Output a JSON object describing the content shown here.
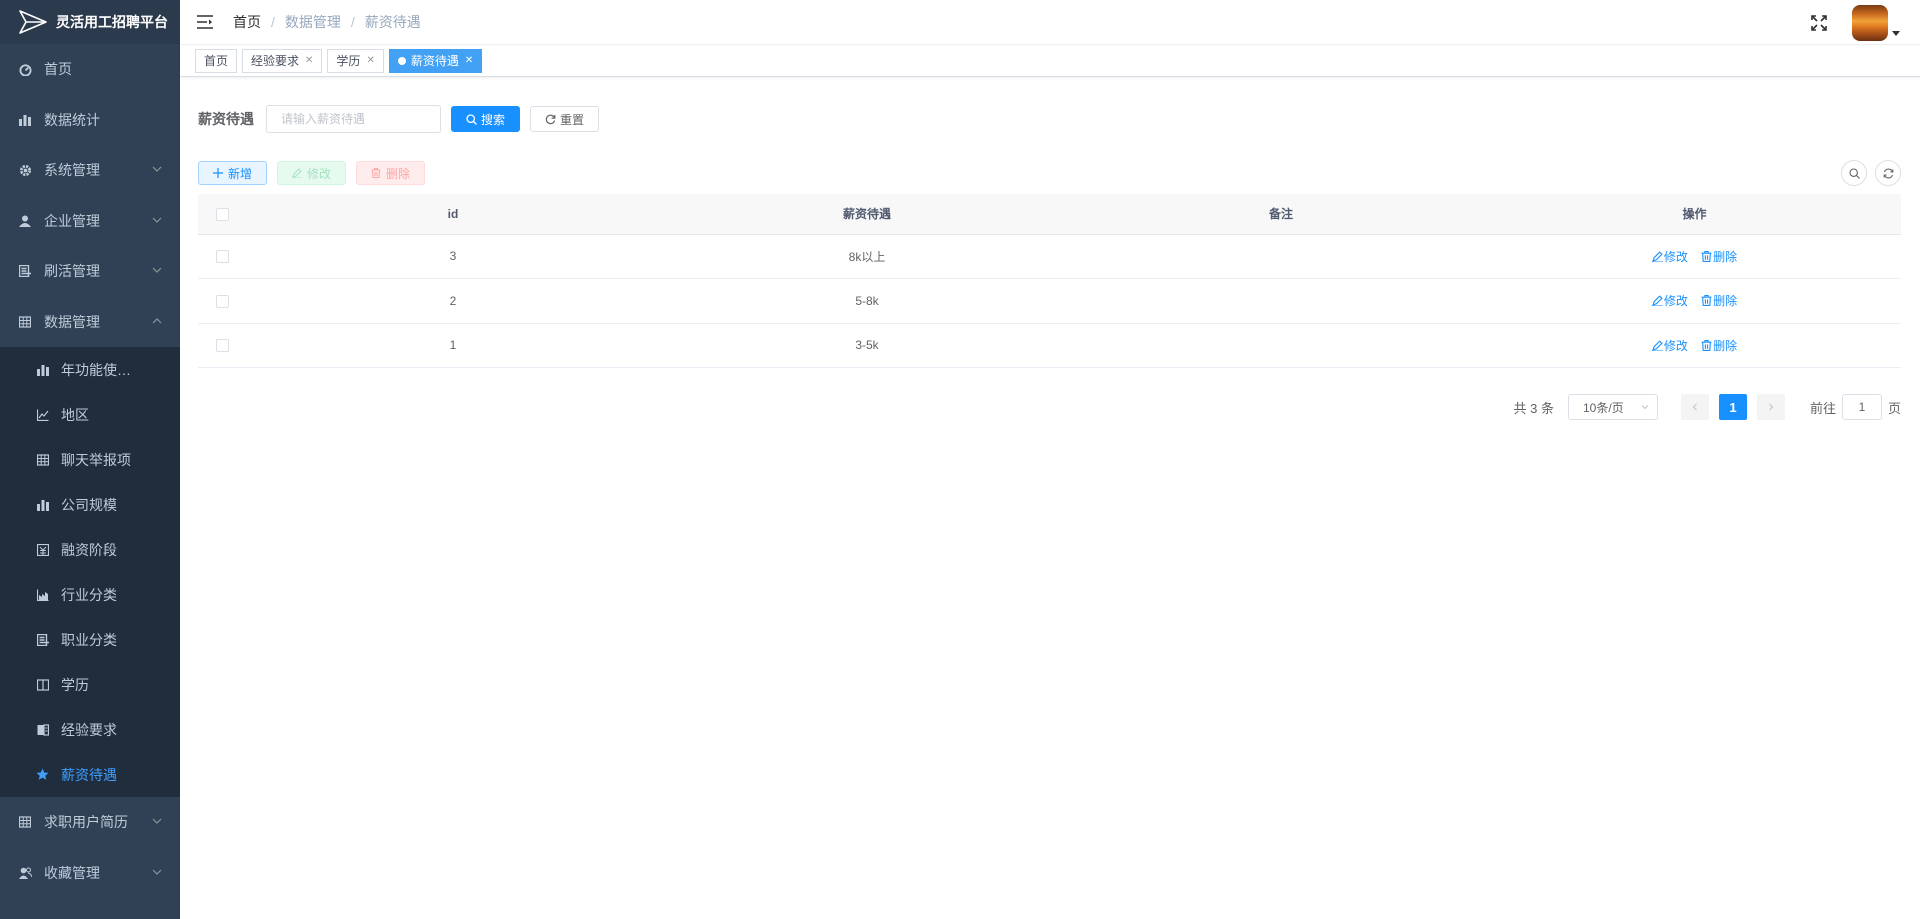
{
  "app": {
    "title": "灵活用工招聘平台"
  },
  "sidebar": {
    "items": [
      {
        "label": "首页",
        "icon": "dashboard-icon"
      },
      {
        "label": "数据统计",
        "icon": "bar-chart-icon"
      },
      {
        "label": "系统管理",
        "icon": "gear-icon",
        "expandable": true
      },
      {
        "label": "企业管理",
        "icon": "user-icon",
        "expandable": true
      },
      {
        "label": "刷活管理",
        "icon": "document-icon",
        "expandable": true
      },
      {
        "label": "数据管理",
        "icon": "table-icon",
        "expandable": true,
        "expanded": true
      }
    ],
    "sub_items": [
      {
        "label": "年功能使用...",
        "icon": "bar-chart-icon"
      },
      {
        "label": "地区",
        "icon": "line-chart-icon"
      },
      {
        "label": "聊天举报项",
        "icon": "table-icon"
      },
      {
        "label": "公司规模",
        "icon": "bar-chart-icon"
      },
      {
        "label": "融资阶段",
        "icon": "money-icon"
      },
      {
        "label": "行业分类",
        "icon": "industry-icon"
      },
      {
        "label": "职业分类",
        "icon": "document-icon"
      },
      {
        "label": "学历",
        "icon": "book-icon"
      },
      {
        "label": "经验要求",
        "icon": "experience-icon"
      },
      {
        "label": "薪资待遇",
        "icon": "star-icon",
        "active": true
      }
    ],
    "bottom_items": [
      {
        "label": "求职用户简历",
        "icon": "table-icon",
        "expandable": true
      },
      {
        "label": "收藏管理",
        "icon": "peoples-icon",
        "expandable": true
      }
    ]
  },
  "navbar": {
    "breadcrumb": [
      "首页",
      "数据管理",
      "薪资待遇"
    ]
  },
  "tags": [
    {
      "label": "首页",
      "closable": false
    },
    {
      "label": "经验要求",
      "closable": true
    },
    {
      "label": "学历",
      "closable": true
    },
    {
      "label": "薪资待遇",
      "closable": true,
      "active": true
    }
  ],
  "search": {
    "label": "薪资待遇",
    "placeholder": "请输入薪资待遇",
    "search_button": "搜索",
    "reset_button": "重置"
  },
  "toolbar": {
    "add_label": "新增",
    "edit_label": "修改",
    "delete_label": "删除"
  },
  "table": {
    "columns": [
      "id",
      "薪资待遇",
      "备注",
      "操作"
    ],
    "rows": [
      {
        "id": "3",
        "salary": "8k以上",
        "remark": ""
      },
      {
        "id": "2",
        "salary": "5-8k",
        "remark": ""
      },
      {
        "id": "1",
        "salary": "3-5k",
        "remark": ""
      }
    ],
    "row_edit_label": "修改",
    "row_delete_label": "删除"
  },
  "pagination": {
    "total_text": "共 3 条",
    "page_size": "10条/页",
    "current_page": "1",
    "goto_prefix": "前往",
    "goto_value": "1",
    "goto_suffix": "页"
  },
  "colors": {
    "sidebar_bg": "#304156",
    "submenu_bg": "#1f2d3d",
    "primary": "#1890ff",
    "active_tag": "#42a1f4"
  }
}
